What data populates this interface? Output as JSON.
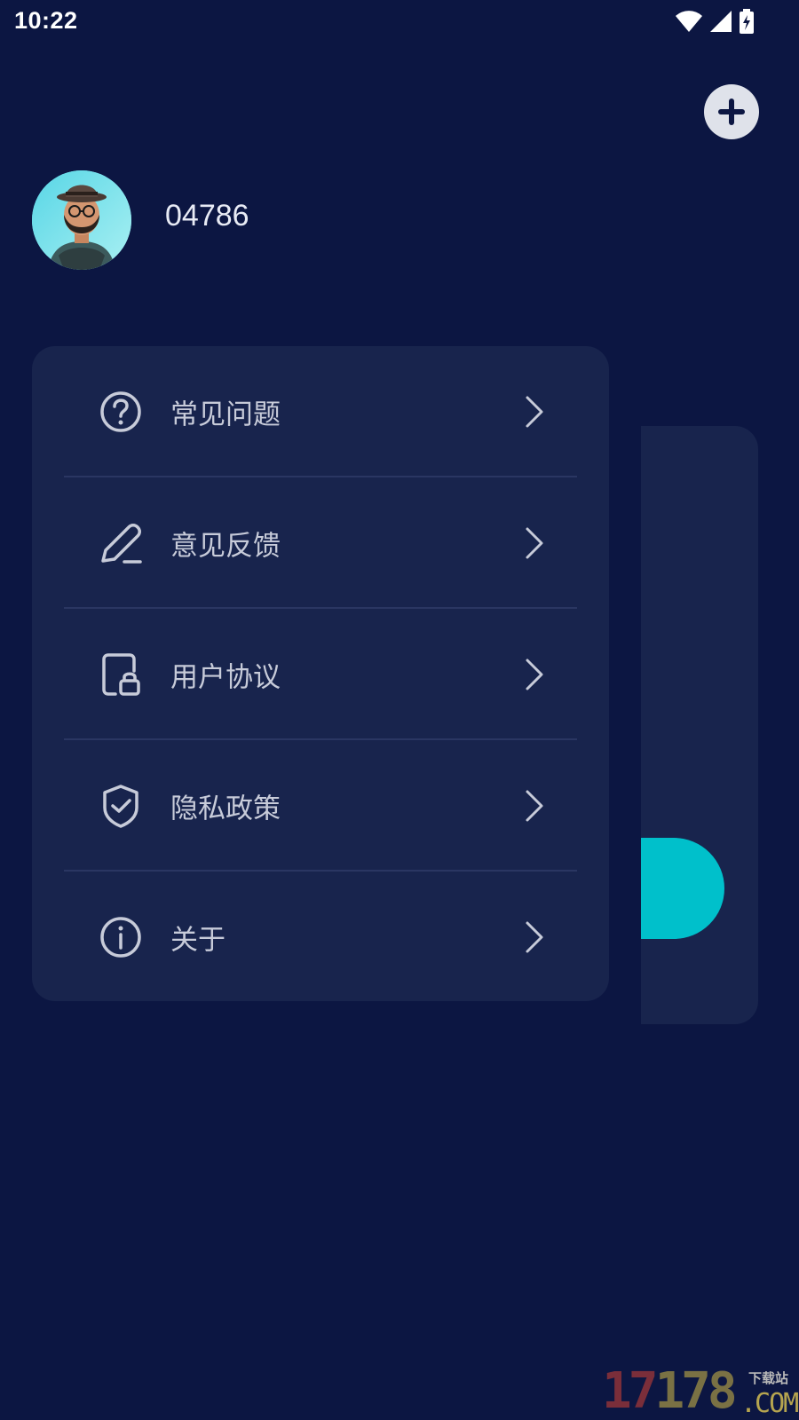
{
  "status_bar": {
    "time": "10:22",
    "icons": [
      "wifi-icon",
      "signal-icon",
      "battery-charging-icon"
    ]
  },
  "header": {
    "add_button_icon": "plus-icon"
  },
  "profile": {
    "user_id": "04786",
    "avatar": "user-avatar"
  },
  "menu": {
    "items": [
      {
        "label": "常见问题",
        "icon": "help-circle-icon"
      },
      {
        "label": "意见反馈",
        "icon": "pencil-icon"
      },
      {
        "label": "用户协议",
        "icon": "document-lock-icon"
      },
      {
        "label": "隐私政策",
        "icon": "shield-check-icon"
      },
      {
        "label": "关于",
        "icon": "info-circle-icon"
      }
    ]
  },
  "watermark": {
    "number": "17178",
    "tagline": "下载站",
    "domain": ".COM"
  },
  "colors": {
    "background": "#0c1642",
    "card": "#18244d",
    "accent": "#00c0cb",
    "text_primary": "#e8ebf5",
    "text_secondary": "#c7cbd9"
  }
}
